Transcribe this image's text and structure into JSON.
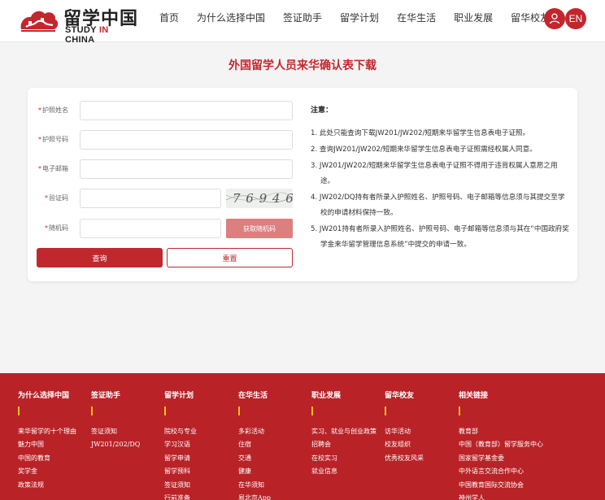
{
  "header": {
    "logo_cn": "留学中国",
    "logo_en_pre": "STUDY ",
    "logo_en_in": "IN",
    "logo_en_post": " CHINA",
    "nav": [
      "首页",
      "为什么选择中国",
      "签证助手",
      "留学计划",
      "在华生活",
      "职业发展",
      "留华校友"
    ],
    "lang_label": "EN"
  },
  "page": {
    "title": "外国留学人员来华确认表下载"
  },
  "form": {
    "passport_name_label": "护照姓名",
    "passport_no_label": "护照号码",
    "email_label": "电子邮箱",
    "captcha_label": "验证码",
    "captcha_text": "7 6 9 4 6",
    "random_code_label": "随机码",
    "get_code_button": "获取随机码",
    "query_button": "查询",
    "reset_button": "重置",
    "required_mark": "*"
  },
  "notice": {
    "title": "注意：",
    "items": [
      "1. 此处只能查询下载JW201/JW202/短期来华留学生信息表电子证照。",
      "2. 查询JW201/JW202/短期来华留学生信息表电子证照需经权属人同意。",
      "3. JW201/JW202/短期来华留学生信息表电子证照不得用于违背权属人意愿之用途。",
      "4. JW202/DQ持有者所录入护照姓名、护照号码、电子邮箱等信息须与其提交至学校的申请材料保持一致。",
      "5. JW201持有者所录入护照姓名、护照号码、电子邮箱等信息须与其在“中国政府奖学金来华留学管理信息系统”中提交的申请一致。"
    ]
  },
  "footer": {
    "columns": [
      {
        "title": "为什么选择中国",
        "links": [
          "来华留学的十个理由",
          "魅力中国",
          "中国的教育",
          "奖学金",
          "政策法规"
        ]
      },
      {
        "title": "签证助手",
        "links": [
          "签证须知",
          "JW201/202/DQ"
        ]
      },
      {
        "title": "留学计划",
        "links": [
          "院校与专业",
          "学习汉语",
          "留学申请",
          "留学预科",
          "签证须知",
          "行前准备"
        ]
      },
      {
        "title": "在华生活",
        "links": [
          "多彩活动",
          "住宿",
          "交通",
          "健康",
          "在华须知",
          "易北京App"
        ]
      },
      {
        "title": "职业发展",
        "links": [
          "实习、就业与创业政策",
          "招聘会",
          "在校实习",
          "就业信息"
        ]
      },
      {
        "title": "留华校友",
        "links": [
          "访华活动",
          "校友组织",
          "优秀校友风采"
        ]
      },
      {
        "title": "相关链接",
        "links": [
          "教育部",
          "中国（教育部）留学服务中心",
          "国家留学基金委",
          "中外语言交流合作中心",
          "中国教育国际交流协会",
          "神州学人"
        ]
      }
    ]
  },
  "colors": {
    "brand_red": "#c4262e",
    "footer_red": "#b92227",
    "accent_yellow": "#f2c21a",
    "random_code_button": "#dc7f7f"
  },
  "icons": {
    "logo": "great-wall-cloud-logo-icon",
    "user": "user-icon"
  }
}
